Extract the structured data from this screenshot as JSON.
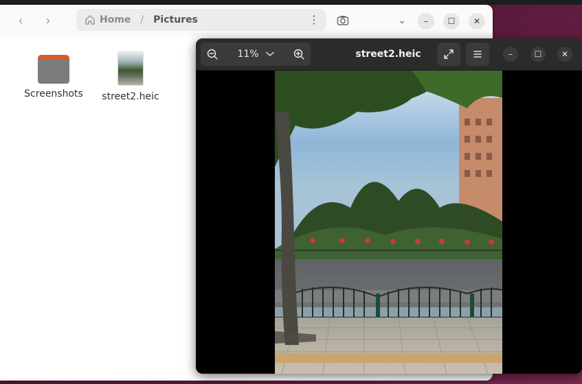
{
  "files_window": {
    "path": {
      "home": "Home",
      "current": "Pictures"
    },
    "items": [
      {
        "name": "Screenshots",
        "kind": "folder"
      },
      {
        "name": "street2.heic",
        "kind": "image"
      }
    ],
    "icons": {
      "back": "chevron-left-icon",
      "forward": "chevron-right-icon",
      "home": "home-icon",
      "menu": "kebab-menu-icon",
      "search": "search-icon",
      "view_options": "chevron-down-icon"
    }
  },
  "viewer_window": {
    "title": "street2.heic",
    "zoom_level": "11%",
    "icons": {
      "zoom_out": "zoom-out-icon",
      "zoom_in": "zoom-in-icon",
      "fullscreen": "fullscreen-icon",
      "menu": "hamburger-menu-icon"
    }
  },
  "colors": {
    "desktop_accent": "#5b1b3e",
    "folder_tab": "#d85a2a",
    "viewer_bg": "#000000",
    "viewer_header": "#2b2b2b"
  }
}
